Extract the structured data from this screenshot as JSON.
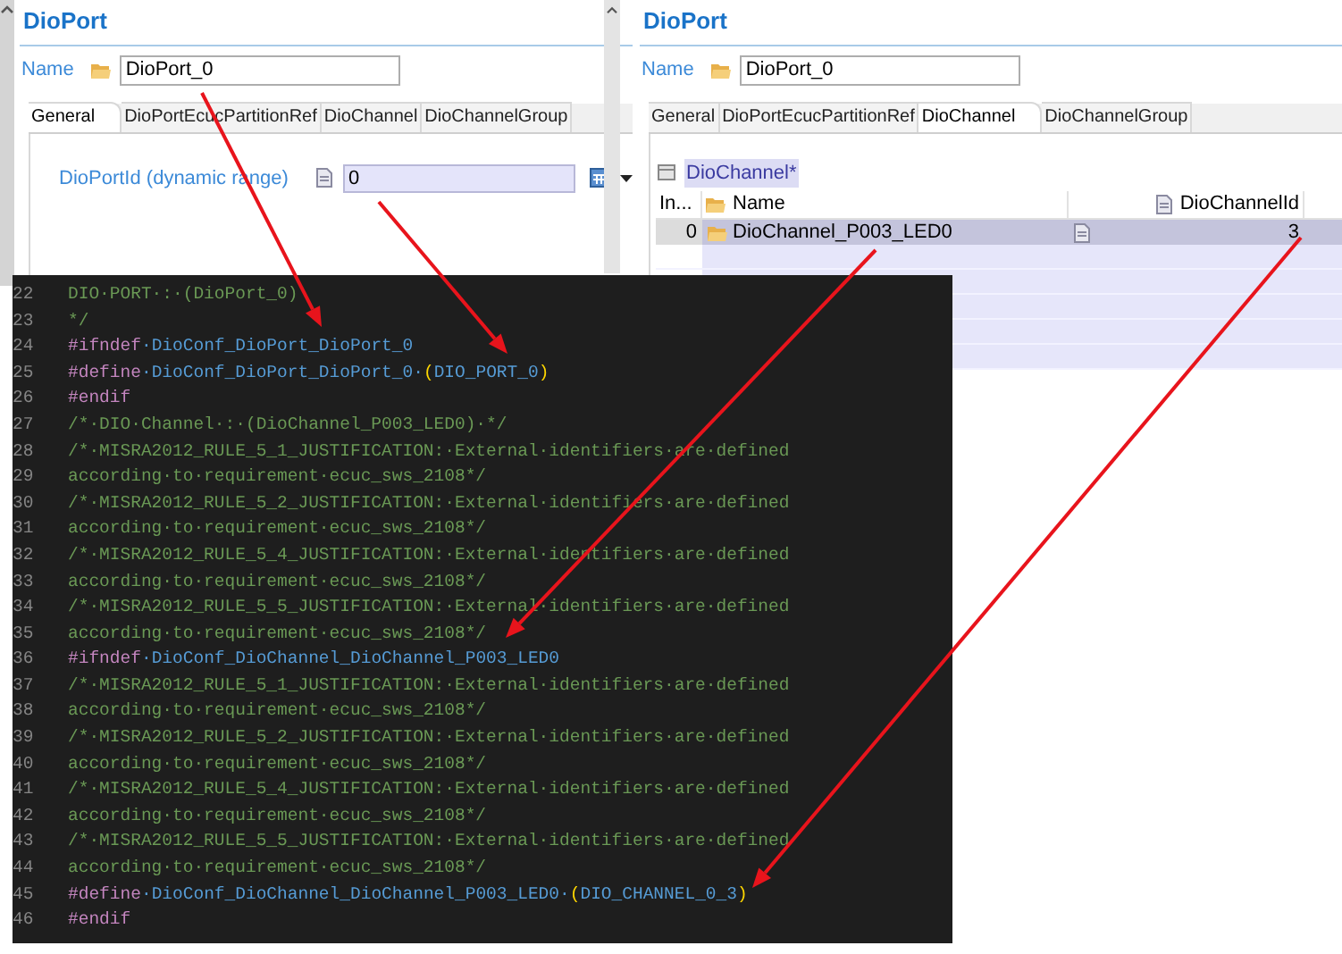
{
  "panels": [
    {
      "kind": "form",
      "title": "DioPort",
      "name_label": "Name",
      "name_value": "DioPort_0",
      "tabs": [
        {
          "label": "General",
          "selected": true
        },
        {
          "label": "DioPortEcucPartitionRef",
          "selected": false
        },
        {
          "label": "DioChannel",
          "selected": false
        },
        {
          "label": "DioChannelGroup",
          "selected": false
        }
      ],
      "field": {
        "label": "DioPortId (dynamic range)",
        "value": "0"
      }
    },
    {
      "kind": "table",
      "title": "DioPort",
      "name_label": "Name",
      "name_value": "DioPort_0",
      "tabs": [
        {
          "label": "General",
          "selected": false
        },
        {
          "label": "DioPortEcucPartitionRef",
          "selected": false
        },
        {
          "label": "DioChannel",
          "selected": true
        },
        {
          "label": "DioChannelGroup",
          "selected": false
        }
      ],
      "table": {
        "caption": "DioChannel*",
        "columns": [
          "In...",
          "Name",
          "DioChannelId"
        ],
        "rows": [
          {
            "cells": [
              "0",
              "DioChannel_P003_LED0",
              "3"
            ],
            "selected": true
          }
        ]
      }
    }
  ],
  "code": {
    "lines": [
      {
        "number": "22",
        "tokens": [
          {
            "kind": "comment",
            "text": "DIO·PORT·:·(DioPort_0)"
          }
        ]
      },
      {
        "number": "23",
        "tokens": [
          {
            "kind": "comment",
            "text": "*/"
          }
        ]
      },
      {
        "number": "24",
        "tokens": [
          {
            "kind": "directive",
            "text": "#ifndef"
          },
          {
            "kind": "ident",
            "text": "·DioConf_DioPort_DioPort_0"
          }
        ]
      },
      {
        "number": "25",
        "tokens": [
          {
            "kind": "directive",
            "text": "#define"
          },
          {
            "kind": "ident",
            "text": "·DioConf_DioPort_DioPort_0·"
          },
          {
            "kind": "paren",
            "text": "("
          },
          {
            "kind": "ident",
            "text": "DIO_PORT_0"
          },
          {
            "kind": "paren",
            "text": ")"
          }
        ]
      },
      {
        "number": "26",
        "tokens": [
          {
            "kind": "directive",
            "text": "#endif"
          }
        ]
      },
      {
        "number": "27",
        "tokens": [
          {
            "kind": "comment",
            "text": "/*·DIO·Channel·:·(DioChannel_P003_LED0)·*/"
          }
        ]
      },
      {
        "number": "28",
        "tokens": [
          {
            "kind": "comment",
            "text": "/*·MISRA2012_RULE_5_1_JUSTIFICATION:·External·identifiers·are·defined"
          }
        ]
      },
      {
        "number": "29",
        "tokens": [
          {
            "kind": "comment",
            "text": "according·to·requirement·ecuc_sws_2108*/"
          }
        ]
      },
      {
        "number": "30",
        "tokens": [
          {
            "kind": "comment",
            "text": "/*·MISRA2012_RULE_5_2_JUSTIFICATION:·External·identifiers·are·defined"
          }
        ]
      },
      {
        "number": "31",
        "tokens": [
          {
            "kind": "comment",
            "text": "according·to·requirement·ecuc_sws_2108*/"
          }
        ]
      },
      {
        "number": "32",
        "tokens": [
          {
            "kind": "comment",
            "text": "/*·MISRA2012_RULE_5_4_JUSTIFICATION:·External·identifiers·are·defined"
          }
        ]
      },
      {
        "number": "33",
        "tokens": [
          {
            "kind": "comment",
            "text": "according·to·requirement·ecuc_sws_2108*/"
          }
        ]
      },
      {
        "number": "34",
        "tokens": [
          {
            "kind": "comment",
            "text": "/*·MISRA2012_RULE_5_5_JUSTIFICATION:·External·identifiers·are·defined"
          }
        ]
      },
      {
        "number": "35",
        "tokens": [
          {
            "kind": "comment",
            "text": "according·to·requirement·ecuc_sws_2108*/"
          }
        ]
      },
      {
        "number": "36",
        "tokens": [
          {
            "kind": "directive",
            "text": "#ifndef"
          },
          {
            "kind": "ident",
            "text": "·DioConf_DioChannel_DioChannel_P003_LED0"
          }
        ]
      },
      {
        "number": "37",
        "tokens": [
          {
            "kind": "comment",
            "text": "/*·MISRA2012_RULE_5_1_JUSTIFICATION:·External·identifiers·are·defined"
          }
        ]
      },
      {
        "number": "38",
        "tokens": [
          {
            "kind": "comment",
            "text": "according·to·requirement·ecuc_sws_2108*/"
          }
        ]
      },
      {
        "number": "39",
        "tokens": [
          {
            "kind": "comment",
            "text": "/*·MISRA2012_RULE_5_2_JUSTIFICATION:·External·identifiers·are·defined"
          }
        ]
      },
      {
        "number": "40",
        "tokens": [
          {
            "kind": "comment",
            "text": "according·to·requirement·ecuc_sws_2108*/"
          }
        ]
      },
      {
        "number": "41",
        "tokens": [
          {
            "kind": "comment",
            "text": "/*·MISRA2012_RULE_5_4_JUSTIFICATION:·External·identifiers·are·defined"
          }
        ]
      },
      {
        "number": "42",
        "tokens": [
          {
            "kind": "comment",
            "text": "according·to·requirement·ecuc_sws_2108*/"
          }
        ]
      },
      {
        "number": "43",
        "tokens": [
          {
            "kind": "comment",
            "text": "/*·MISRA2012_RULE_5_5_JUSTIFICATION:·External·identifiers·are·defined"
          }
        ]
      },
      {
        "number": "44",
        "tokens": [
          {
            "kind": "comment",
            "text": "according·to·requirement·ecuc_sws_2108*/"
          }
        ]
      },
      {
        "number": "45",
        "tokens": [
          {
            "kind": "directive",
            "text": "#define"
          },
          {
            "kind": "ident",
            "text": "·DioConf_DioChannel_DioChannel_P003_LED0·"
          },
          {
            "kind": "paren",
            "text": "("
          },
          {
            "kind": "ident",
            "text": "DIO_CHANNEL_0_3"
          },
          {
            "kind": "paren",
            "text": ")"
          }
        ]
      },
      {
        "number": "46",
        "tokens": [
          {
            "kind": "directive",
            "text": "#endif"
          }
        ]
      }
    ]
  }
}
